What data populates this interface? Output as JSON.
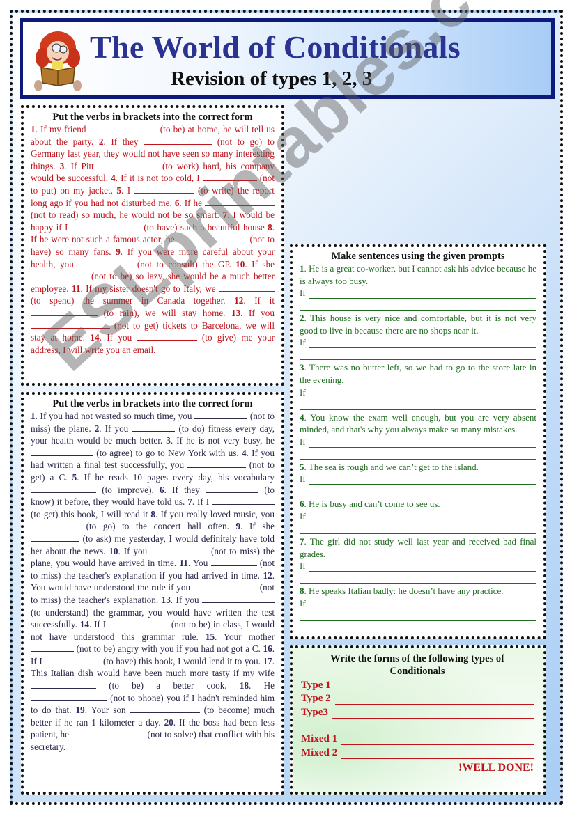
{
  "header": {
    "title": "The World of Conditionals",
    "subtitle": "Revision of types 1, 2, 3",
    "mascot_icon": "girl-reading-book-icon"
  },
  "exercise1": {
    "title": "Put the verbs in brackets into the correct form",
    "segments": [
      {
        "n": "1",
        "pre": "If my friend",
        "verb": "(to be) at home, he will tell us about the party."
      },
      {
        "n": "2",
        "pre": "If they",
        "verb": "(not to go) to Germany last year, they would not have seen so many interesting things."
      },
      {
        "n": "3",
        "pre": "If Pitt",
        "verb": "(to work) hard, his company would be successful."
      },
      {
        "n": "4",
        "pre": "If it is not too cold, I",
        "verb": "(not to put) on my jacket."
      },
      {
        "n": "5",
        "pre": "I",
        "verb": "(to write) the report long ago if you had not disturbed me."
      },
      {
        "n": "6",
        "pre": "If he",
        "verb": "(not to read) so much, he would not be so smart."
      },
      {
        "n": "7",
        "pre": "I would be happy if I",
        "verb": "(to have) such a beautiful house"
      },
      {
        "n": "8",
        "pre": "If he were not such a famous actor, he",
        "verb": "(not to have) so many fans."
      },
      {
        "n": "9",
        "pre": "If you were more careful about your health, you",
        "verb": "(not to consult) the GP."
      },
      {
        "n": "10",
        "pre": "If she",
        "verb": "(not to be) so lazy, she would be a much better employee."
      },
      {
        "n": "11",
        "pre": "If my sister doesn't go to Italy, we",
        "verb": "(to spend) the summer in Canada together."
      },
      {
        "n": "12",
        "pre": "If it",
        "verb": "(to rain), we will stay home."
      },
      {
        "n": "13",
        "pre": "If you",
        "verb": "(not to get) tickets to Barcelona, we will stay at home."
      },
      {
        "n": "14",
        "pre": "If you",
        "verb": "(to give) me your address, I will write you an email."
      }
    ]
  },
  "exercise2": {
    "title": "Put the verbs in brackets into the correct form",
    "segments": [
      {
        "n": "1",
        "pre": "If you had not wasted so much time, you",
        "verb": "(not to miss) the plane."
      },
      {
        "n": "2",
        "pre": "If you",
        "verb": "(to do) fitness every day, your health would be much better."
      },
      {
        "n": "3",
        "pre": "If he is not very busy, he",
        "verb": "(to agree) to go to New York with us."
      },
      {
        "n": "4",
        "pre": "If you had written a final test successfully, you",
        "verb": "(not to get) a C."
      },
      {
        "n": "5",
        "pre": "If he reads 10 pages every day, his vocabulary",
        "verb": "(to improve)."
      },
      {
        "n": "6",
        "pre": "If they",
        "verb": "(to know) it before, they would have told us."
      },
      {
        "n": "7",
        "pre": "If I",
        "verb": "(to get) this book, I will read it"
      },
      {
        "n": "8",
        "pre": "If you really loved music, you",
        "verb": "(to go) to the concert hall often."
      },
      {
        "n": "9",
        "pre": "If she",
        "verb": "(to ask) me yesterday, I would definitely have told her about the news."
      },
      {
        "n": "10",
        "pre": "If you",
        "verb": "(not to miss) the plane, you would have arrived in time."
      },
      {
        "n": "11",
        "pre": "You",
        "verb": "(not to miss) the teacher's explanation if you had arrived in time."
      },
      {
        "n": "12",
        "pre": "You would have understood the rule if you",
        "verb": "(not to miss) the teacher's explanation."
      },
      {
        "n": "13",
        "pre": "If you",
        "verb": "(to understand) the grammar, you would have written the test successfully."
      },
      {
        "n": "14",
        "pre": "If I",
        "verb": "(not to be) in class, I would not have understood this grammar rule."
      },
      {
        "n": "15",
        "pre": "Your mother",
        "verb": "(not to be) angry with you if you had not got a C."
      },
      {
        "n": "16",
        "pre": "If I",
        "verb": "(to have) this book, I would lend it to you."
      },
      {
        "n": "17",
        "pre": "This Italian dish would have been much more tasty if my wife",
        "verb": "(to be) a better cook."
      },
      {
        "n": "18",
        "pre": "He",
        "verb": "(not to phone) you if I hadn't reminded him to do that."
      },
      {
        "n": "19",
        "pre": "Your son",
        "verb": "(to become) much better if he ran 1 kilometer a day."
      },
      {
        "n": "20",
        "pre": "If the boss had been less patient, he",
        "verb": "(not to solve) that conflict with his secretary."
      }
    ]
  },
  "exercise3": {
    "title": "Make sentences using the given prompts",
    "if_label": "If",
    "prompts": [
      {
        "n": "1",
        "text": "He is a great co-worker, but I cannot ask his advice because he is always too busy."
      },
      {
        "n": "2",
        "text": "This house is very nice and comfortable, but it is not very good to live in because there are no shops near it."
      },
      {
        "n": "3",
        "text": "There was no butter left, so we had to go to the store late in the evening."
      },
      {
        "n": "4",
        "text": "You know the exam well enough, but you are very absent minded, and that's why you always make so many mistakes."
      },
      {
        "n": "5",
        "text": " The sea is rough and we can’t get to the island."
      },
      {
        "n": "6",
        "text": "He is busy and can’t come to see us."
      },
      {
        "n": "7",
        "text": "The girl did not study well last year and received bad final grades."
      },
      {
        "n": "8",
        "text": "He speaks Italian badly: he doesn’t have any practice."
      }
    ]
  },
  "exercise4": {
    "title_line1": "Write the forms of the following types of",
    "title_line2": "Conditionals",
    "types": [
      "Type 1",
      "Type 2",
      "Type3"
    ],
    "mixed": [
      "Mixed 1",
      "Mixed 2"
    ],
    "closing": "!WELL DONE!"
  },
  "watermark": "ESLprintables.com",
  "colors": {
    "title_blue": "#2a3391",
    "banner_border": "#0d1a7a",
    "exercise1_red": "#c0141d",
    "exercise2_navy": "#2a2a4a",
    "exercise3_green": "#1f6b1f"
  }
}
